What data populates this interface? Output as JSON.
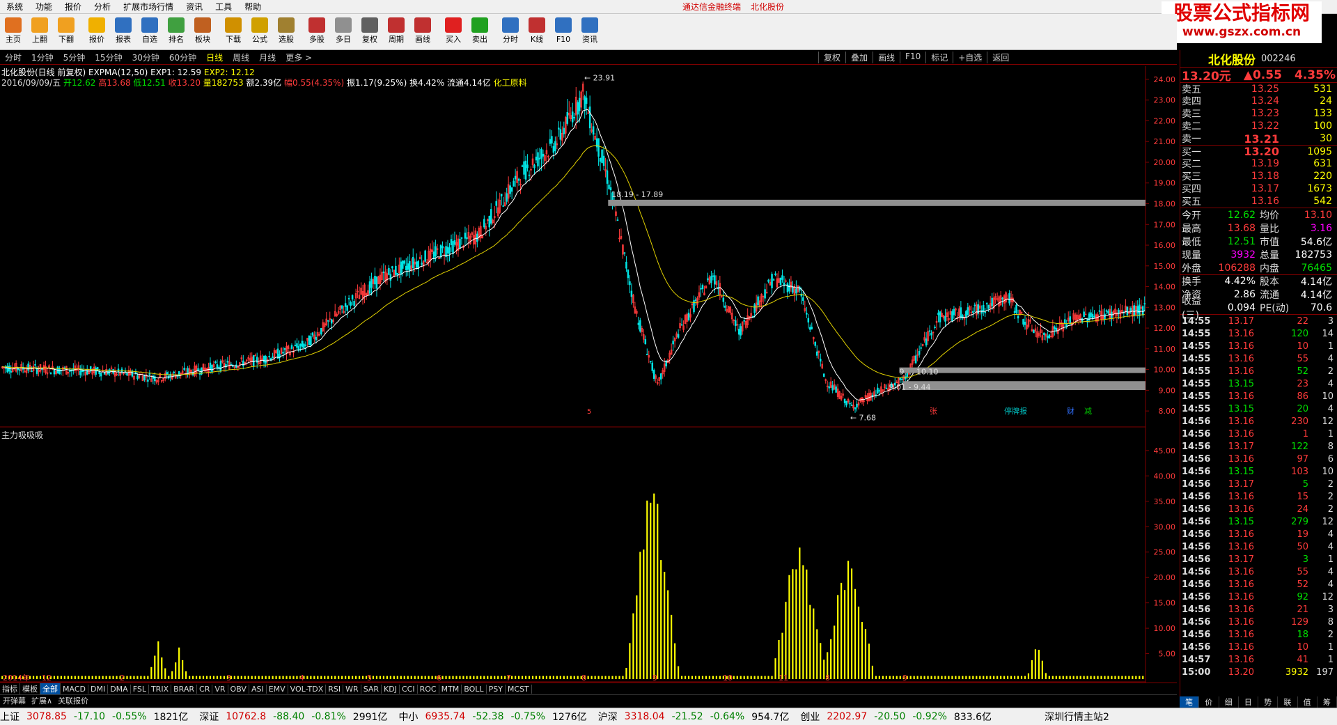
{
  "menu": [
    "系统",
    "功能",
    "报价",
    "分析",
    "扩展市场行情",
    "资讯",
    "工具",
    "帮助"
  ],
  "menu_center": [
    "通达信金融终端",
    "北化股份"
  ],
  "logo": {
    "line1": "股票公式指标网",
    "line2": "www.gszx.com.cn"
  },
  "toolbar": [
    {
      "label": "主页",
      "icon": "home-icon",
      "color": "#e07020"
    },
    {
      "label": "上翻",
      "icon": "arrow-up-icon",
      "color": "#f0a020"
    },
    {
      "label": "下翻",
      "icon": "arrow-down-icon",
      "color": "#f0a020"
    },
    {
      "label": "报价",
      "icon": "quote-icon",
      "color": "#f0b000"
    },
    {
      "label": "报表",
      "icon": "report-icon",
      "color": "#3070c0"
    },
    {
      "label": "自选",
      "icon": "watchlist-icon",
      "color": "#3070c0"
    },
    {
      "label": "排名",
      "icon": "rank-icon",
      "color": "#40a040"
    },
    {
      "label": "板块",
      "icon": "sector-icon",
      "color": "#c06020"
    },
    {
      "label": "下载",
      "icon": "download-icon",
      "color": "#d09000"
    },
    {
      "label": "公式",
      "icon": "formula-icon",
      "color": "#d0a000"
    },
    {
      "label": "选股",
      "icon": "select-stock-icon",
      "color": "#a08030"
    },
    {
      "label": "多股",
      "icon": "multi-stock-icon",
      "color": "#c03030"
    },
    {
      "label": "多日",
      "icon": "multi-day-icon",
      "color": "#909090"
    },
    {
      "label": "复权",
      "icon": "adjust-icon",
      "color": "#606060"
    },
    {
      "label": "周期",
      "icon": "period-icon",
      "color": "#c03030"
    },
    {
      "label": "画线",
      "icon": "draw-line-icon",
      "color": "#c03030"
    },
    {
      "label": "买入",
      "icon": "buy-icon",
      "color": "#e02020"
    },
    {
      "label": "卖出",
      "icon": "sell-icon",
      "color": "#20a020"
    },
    {
      "label": "分时",
      "icon": "intraday-icon",
      "color": "#3070c0"
    },
    {
      "label": "K线",
      "icon": "kline-icon",
      "color": "#c03030"
    },
    {
      "label": "F10",
      "icon": "f10-icon",
      "color": "#3070c0"
    },
    {
      "label": "资讯",
      "icon": "news-icon",
      "color": "#3070c0"
    }
  ],
  "periods": [
    "分时",
    "1分钟",
    "5分钟",
    "15分钟",
    "30分钟",
    "60分钟",
    "日线",
    "周线",
    "月线",
    "更多 >"
  ],
  "active_period": "日线",
  "chart_buttons": [
    "复权",
    "叠加",
    "画线",
    "F10",
    "标记",
    "+自选",
    "返回"
  ],
  "chart": {
    "title": "北化股份(日线 前复权) EXPMA(12,50) EXP1: 12.59 EXP2: 12.12",
    "title_parts": {
      "name": "北化股份(日线 前复权) EXPMA(12,50)",
      "exp1": "EXP1: 12.59",
      "exp2": "EXP2: 12.12"
    },
    "date": "2016/09/09/五",
    "open": "开12.62",
    "high": "高13.68",
    "low": "低12.51",
    "close": "收13.20",
    "volume": "量182753",
    "amount": "额2.39亿",
    "change": "幅0.55(4.35%)",
    "amplitude": "振1.17(9.25%)",
    "turnover": "换4.42%",
    "float": "流通4.14亿",
    "industry": "化工原料",
    "y_ticks": [
      "24.00",
      "23.00",
      "22.00",
      "21.00",
      "20.00",
      "19.00",
      "18.00",
      "17.00",
      "16.00",
      "15.00",
      "14.00",
      "13.00",
      "12.00",
      "11.00",
      "10.00",
      "9.00",
      "8.00"
    ],
    "annotations": {
      "peak": "23.91",
      "low": "7.68",
      "gap1": "18.19 - 17.89",
      "gap2": "9.01 - 9.44",
      "gap3": "9. .. 10.10"
    },
    "markers": [
      "张",
      "停牌报",
      "财",
      "减"
    ],
    "marker5": "5",
    "x_months": [
      "2014年",
      "12",
      "2",
      "3",
      "4",
      "5",
      "6",
      "7",
      "8",
      "9",
      "10",
      "11",
      "8",
      "9"
    ]
  },
  "sub_chart": {
    "title": "主力吸吸吸",
    "y_ticks": [
      "45.00",
      "40.00",
      "35.00",
      "30.00",
      "25.00",
      "20.00",
      "15.00",
      "10.00",
      "5.00"
    ],
    "period_label": "日线"
  },
  "indicator_tabs": [
    "指标",
    "模板",
    "全部",
    "MACD",
    "DMI",
    "DMA",
    "FSL",
    "TRIX",
    "BRAR",
    "CR",
    "VR",
    "OBV",
    "ASI",
    "EMV",
    "VOL-TDX",
    "RSI",
    "WR",
    "SAR",
    "KDJ",
    "CCI",
    "ROC",
    "MTM",
    "BOLL",
    "PSY",
    "MCST"
  ],
  "active_indicator_tab": "全部",
  "extra_tabs": [
    "开弹幕",
    "扩展∧",
    "关联报价"
  ],
  "status": [
    {
      "name": "上证",
      "val": "3078.85",
      "chg": "-17.10",
      "pct": "-0.55%",
      "amt": "1821亿"
    },
    {
      "name": "深证",
      "val": "10762.8",
      "chg": "-88.40",
      "pct": "-0.81%",
      "amt": "2991亿"
    },
    {
      "name": "中小",
      "val": "6935.74",
      "chg": "-52.38",
      "pct": "-0.75%",
      "amt": "1276亿"
    },
    {
      "name": "沪深",
      "val": "3318.04",
      "chg": "-21.52",
      "pct": "-0.64%",
      "amt": "954.7亿"
    },
    {
      "name": "创业",
      "val": "2202.97",
      "chg": "-20.50",
      "pct": "-0.92%",
      "amt": "833.6亿"
    }
  ],
  "server": "深圳行情主站2",
  "quote": {
    "name": "北化股份",
    "code": "002246",
    "price": "13.20元",
    "chg": "▲0.55",
    "pct": "4.35%",
    "sells": [
      {
        "k": "卖五",
        "p": "13.25",
        "q": "531"
      },
      {
        "k": "卖四",
        "p": "13.24",
        "q": "24"
      },
      {
        "k": "卖三",
        "p": "13.23",
        "q": "133"
      },
      {
        "k": "卖二",
        "p": "13.22",
        "q": "100"
      },
      {
        "k": "卖一",
        "p": "13.21",
        "q": "30"
      }
    ],
    "buys": [
      {
        "k": "买一",
        "p": "13.20",
        "q": "1095"
      },
      {
        "k": "买二",
        "p": "13.19",
        "q": "631"
      },
      {
        "k": "买三",
        "p": "13.18",
        "q": "220"
      },
      {
        "k": "买四",
        "p": "13.17",
        "q": "1673"
      },
      {
        "k": "买五",
        "p": "13.16",
        "q": "542"
      }
    ],
    "stats": [
      {
        "k": "今开",
        "v": "12.62",
        "k2": "均价",
        "v2": "13.10"
      },
      {
        "k": "最高",
        "v": "13.68",
        "k2": "量比",
        "v2": "3.16"
      },
      {
        "k": "最低",
        "v": "12.51",
        "k2": "市值",
        "v2": "54.6亿"
      },
      {
        "k": "现量",
        "v": "3932",
        "k2": "总量",
        "v2": "182753"
      },
      {
        "k": "外盘",
        "v": "106288",
        "k2": "内盘",
        "v2": "76465"
      },
      {
        "k": "换手",
        "v": "4.42%",
        "k2": "股本",
        "v2": "4.14亿"
      },
      {
        "k": "净资",
        "v": "2.86",
        "k2": "流通",
        "v2": "4.14亿"
      },
      {
        "k": "收益(三)",
        "v": "0.094",
        "k2": "PE(动)",
        "v2": "70.6"
      }
    ],
    "ticks": [
      [
        "14:55",
        "13.17",
        "22",
        "3"
      ],
      [
        "14:55",
        "13.16",
        "120",
        "14"
      ],
      [
        "14:55",
        "13.16",
        "10",
        "1"
      ],
      [
        "14:55",
        "13.16",
        "55",
        "4"
      ],
      [
        "14:55",
        "13.16",
        "52",
        "2"
      ],
      [
        "14:55",
        "13.15",
        "23",
        "4"
      ],
      [
        "14:55",
        "13.16",
        "86",
        "10"
      ],
      [
        "14:55",
        "13.15",
        "20",
        "4"
      ],
      [
        "14:56",
        "13.16",
        "230",
        "12"
      ],
      [
        "14:56",
        "13.16",
        "1",
        "1"
      ],
      [
        "14:56",
        "13.17",
        "122",
        "8"
      ],
      [
        "14:56",
        "13.16",
        "97",
        "6"
      ],
      [
        "14:56",
        "13.15",
        "103",
        "10"
      ],
      [
        "14:56",
        "13.17",
        "5",
        "2"
      ],
      [
        "14:56",
        "13.16",
        "15",
        "2"
      ],
      [
        "14:56",
        "13.16",
        "24",
        "2"
      ],
      [
        "14:56",
        "13.15",
        "279",
        "12"
      ],
      [
        "14:56",
        "13.16",
        "19",
        "4"
      ],
      [
        "14:56",
        "13.16",
        "50",
        "4"
      ],
      [
        "14:56",
        "13.17",
        "3",
        "1"
      ],
      [
        "14:56",
        "13.16",
        "55",
        "4"
      ],
      [
        "14:56",
        "13.16",
        "52",
        "4"
      ],
      [
        "14:56",
        "13.16",
        "92",
        "12"
      ],
      [
        "14:56",
        "13.16",
        "21",
        "3"
      ],
      [
        "14:56",
        "13.16",
        "129",
        "8"
      ],
      [
        "14:56",
        "13.16",
        "18",
        "2"
      ],
      [
        "14:56",
        "13.16",
        "10",
        "1"
      ],
      [
        "14:57",
        "13.16",
        "41",
        "1"
      ],
      [
        "15:00",
        "13.20",
        "3932",
        "197"
      ]
    ],
    "tabs": [
      "笔",
      "价",
      "细",
      "日",
      "势",
      "联",
      "值",
      "筹"
    ]
  },
  "chart_data": {
    "type": "candlestick",
    "title": "北化股份(日线 前复权)",
    "ylim": [
      7.5,
      24.3
    ],
    "indicators": [
      "EXPMA(12,50)"
    ],
    "last": {
      "open": 12.62,
      "high": 13.68,
      "low": 12.51,
      "close": 13.2
    },
    "peak": 23.91,
    "trough": 7.68,
    "gaps": [
      [
        17.89,
        18.19
      ],
      [
        9.01,
        9.44
      ],
      [
        9.9,
        10.1
      ]
    ],
    "anchors": [
      [
        0,
        10.1
      ],
      [
        60,
        9.9
      ],
      [
        90,
        9.6
      ],
      [
        120,
        10.1
      ],
      [
        150,
        10.5
      ],
      [
        175,
        11.2
      ],
      [
        200,
        13.2
      ],
      [
        220,
        14.5
      ],
      [
        250,
        15.6
      ],
      [
        275,
        16.5
      ],
      [
        300,
        19.5
      ],
      [
        320,
        21.0
      ],
      [
        335,
        23.3
      ],
      [
        350,
        19.0
      ],
      [
        365,
        13.0
      ],
      [
        378,
        9.2
      ],
      [
        390,
        11.8
      ],
      [
        410,
        14.6
      ],
      [
        425,
        11.8
      ],
      [
        445,
        14.4
      ],
      [
        460,
        13.8
      ],
      [
        475,
        9.5
      ],
      [
        490,
        8.2
      ],
      [
        505,
        8.9
      ],
      [
        520,
        9.5
      ],
      [
        540,
        12.5
      ],
      [
        560,
        12.8
      ],
      [
        580,
        13.5
      ],
      [
        590,
        12.3
      ],
      [
        600,
        11.6
      ],
      [
        620,
        12.5
      ],
      [
        660,
        12.9
      ]
    ],
    "sub_series": {
      "name": "主力吸吸吸",
      "ylim": [
        0,
        48
      ],
      "peaks": [
        [
          90,
          7.5
        ],
        [
          102,
          6.5
        ],
        [
          375,
          47
        ],
        [
          460,
          33
        ],
        [
          488,
          28
        ],
        [
          597,
          8.5
        ]
      ]
    }
  }
}
